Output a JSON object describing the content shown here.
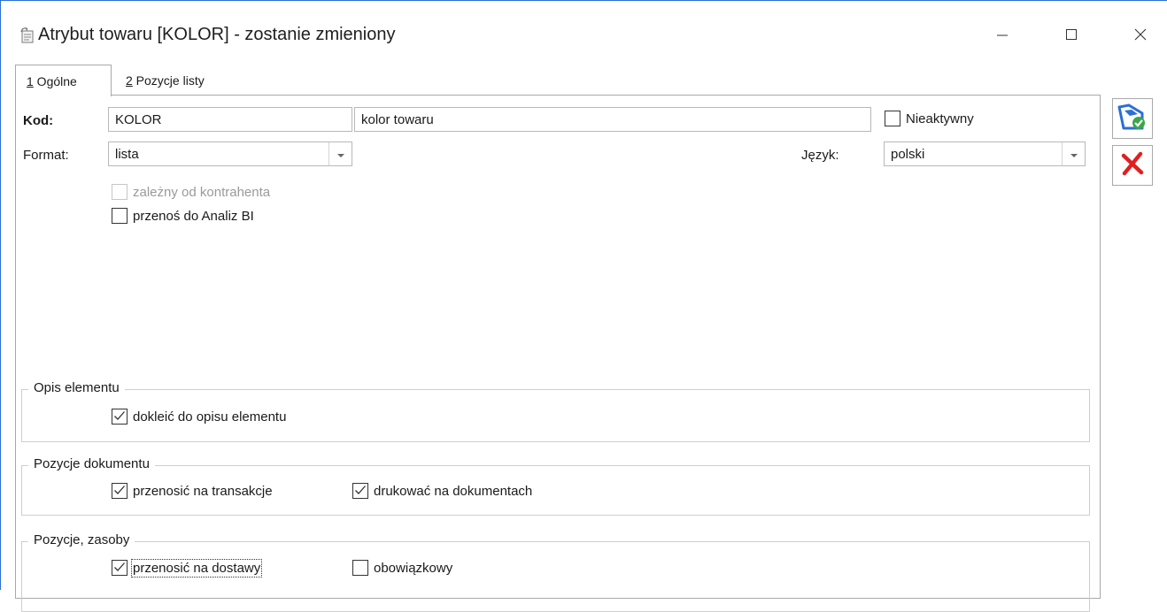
{
  "window": {
    "title": "Atrybut towaru [KOLOR] - zostanie zmieniony",
    "minimize_icon": "minimize-icon",
    "maximize_icon": "maximize-icon",
    "close_icon": "close-icon"
  },
  "tabs": [
    {
      "hotkey": "1",
      "label": " Ogólne"
    },
    {
      "hotkey": "2",
      "label": " Pozycje listy"
    }
  ],
  "form": {
    "kod_label": "Kod:",
    "kod_value": "KOLOR",
    "nazwa_value": "kolor towaru",
    "nieaktywny_label": "Nieaktywny",
    "nieaktywny_checked": false,
    "format_label": "Format:",
    "format_value": "lista",
    "jezyk_label": "Język:",
    "jezyk_value": "polski",
    "zalezny_label": "zależny od kontrahenta",
    "zalezny_checked": false,
    "przenos_bi_label": "przenoś do Analiz BI",
    "przenos_bi_checked": false
  },
  "groups": {
    "opis": {
      "title": "Opis elementu",
      "dokleic_label": "dokleić do opisu elementu",
      "dokleic_checked": true
    },
    "pozycje_dokumentu": {
      "title": "Pozycje dokumentu",
      "przenosic_transakcje_label": "przenosić na transakcje",
      "przenosic_transakcje_checked": true,
      "drukowac_label": "drukować na dokumentach",
      "drukowac_checked": true
    },
    "pozycje_zasoby": {
      "title": "Pozycje, zasoby",
      "przenosic_dostawy_label": "przenosić na dostawy",
      "przenosic_dostawy_checked": true,
      "obowiazkowy_label": "obowiązkowy",
      "obowiazkowy_checked": false
    }
  },
  "side_buttons": {
    "save_icon": "save-icon",
    "cancel_icon": "cancel-icon"
  },
  "colors": {
    "accent_blue": "#2b6fd6",
    "check_green": "#3aa64a",
    "cancel_red": "#e02020"
  }
}
